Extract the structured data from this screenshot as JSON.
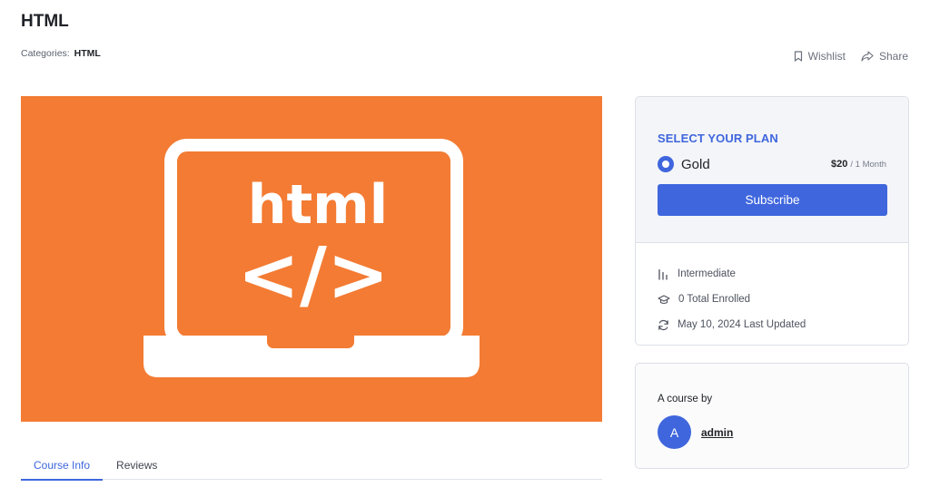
{
  "page": {
    "title": "HTML",
    "categories_label": "Categories:",
    "category": "HTML"
  },
  "actions": {
    "wishlist": "Wishlist",
    "share": "Share"
  },
  "thumbnail": {
    "word": "html",
    "code": "</>",
    "bg_color": "#f37b33"
  },
  "tabs": [
    {
      "label": "Course Info",
      "active": true
    },
    {
      "label": "Reviews",
      "active": false
    }
  ],
  "plan": {
    "heading": "SELECT YOUR PLAN",
    "name": "Gold",
    "price": "$20",
    "period": "/ 1 Month",
    "subscribe_label": "Subscribe",
    "accent": "#3f66dd"
  },
  "meta": {
    "level": "Intermediate",
    "enrolled": "0 Total Enrolled",
    "updated": "May 10, 2024 Last Updated"
  },
  "author": {
    "label": "A course by",
    "initial": "A",
    "name": "admin"
  },
  "icons": [
    "bookmark-icon",
    "share-icon",
    "level-bars-icon",
    "graduation-cap-icon",
    "refresh-icon"
  ]
}
